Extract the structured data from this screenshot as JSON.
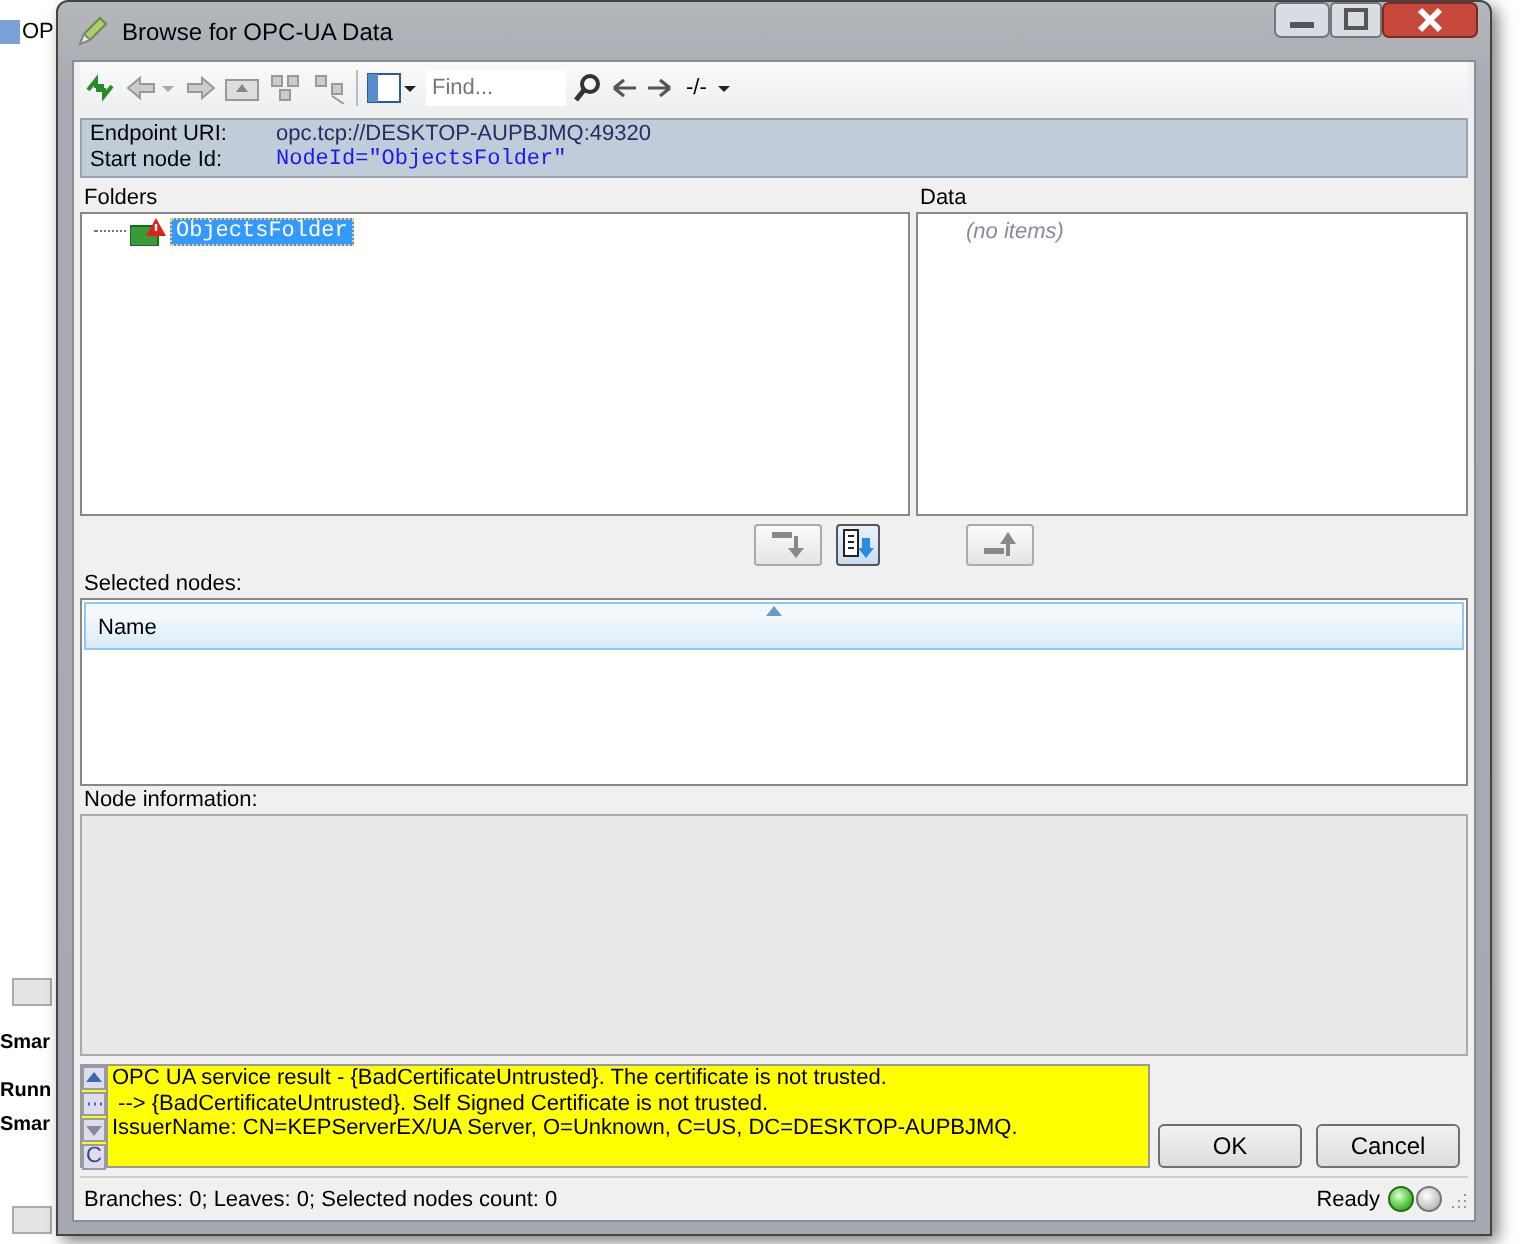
{
  "background_app": {
    "tree_item": "OP",
    "labels": [
      "Smar",
      "Runn",
      "Smar"
    ]
  },
  "window": {
    "title": "Browse for OPC-UA Data"
  },
  "toolbar": {
    "find_placeholder": "Find...",
    "counter": "-/-"
  },
  "endpoint": {
    "uri_label": "Endpoint URI:",
    "uri": "opc.tcp://DESKTOP-AUPBJMQ:49320",
    "node_label": "Start node Id:",
    "node_id": "NodeId=\"ObjectsFolder\""
  },
  "folders": {
    "label": "Folders",
    "tree": [
      {
        "label": "ObjectsFolder",
        "selected": true,
        "warning": true
      }
    ]
  },
  "data": {
    "label": "Data",
    "empty_text": "(no items)"
  },
  "selected_nodes": {
    "label": "Selected nodes:",
    "columns": [
      {
        "label": "Name",
        "sorted": true
      }
    ]
  },
  "node_information": {
    "label": "Node information:"
  },
  "messages": {
    "lines": [
      "OPC UA service result - {BadCertificateUntrusted}. The certificate is not trusted.",
      " --> {BadCertificateUntrusted}. Self Signed Certificate is not trusted.",
      "IssuerName: CN=KEPServerEX/UA Server, O=Unknown, C=US, DC=DESKTOP-AUPBJMQ."
    ],
    "clear_key": "C"
  },
  "buttons": [
    "OK",
    "Cancel"
  ],
  "status_bar": {
    "text": "Branches: 0; Leaves: 0; Selected nodes count: 0",
    "state": "Ready",
    "indicators": [
      {
        "on": true
      },
      {
        "on": false
      }
    ]
  }
}
